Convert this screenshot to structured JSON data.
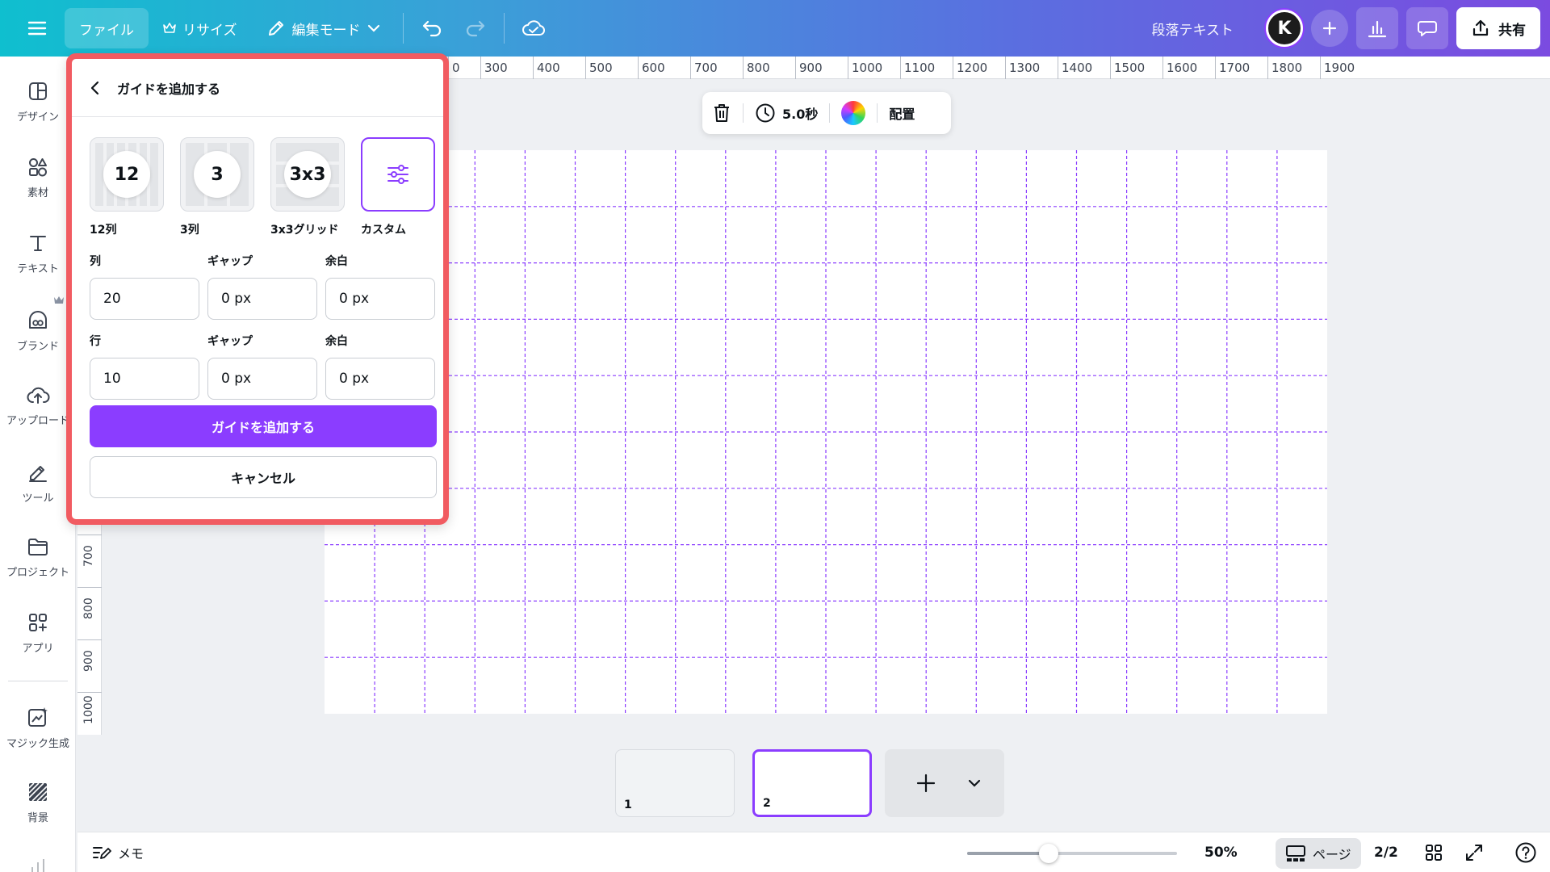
{
  "topbar": {
    "file": "ファイル",
    "resize": "リサイズ",
    "edit_mode": "編集モード",
    "doc_title": "段落テキスト",
    "avatar_text": "K",
    "share": "共有"
  },
  "sidebar": {
    "items": [
      {
        "label": "デザイン",
        "icon": "design-icon"
      },
      {
        "label": "素材",
        "icon": "elements-icon"
      },
      {
        "label": "テキスト",
        "icon": "text-icon"
      },
      {
        "label": "ブランド",
        "icon": "brand-icon"
      },
      {
        "label": "アップロード",
        "icon": "upload-icon"
      },
      {
        "label": "ツール",
        "icon": "tools-icon"
      },
      {
        "label": "プロジェクト",
        "icon": "projects-icon"
      },
      {
        "label": "アプリ",
        "icon": "apps-icon"
      },
      {
        "label": "マジック生成",
        "icon": "magic-icon"
      },
      {
        "label": "背景",
        "icon": "background-icon"
      }
    ]
  },
  "ruler": {
    "top_labels": [
      "0",
      "300",
      "400",
      "500",
      "600",
      "700",
      "800",
      "900",
      "1000",
      "1100",
      "1200",
      "1300",
      "1400",
      "1500",
      "1600",
      "1700",
      "1800",
      "1900"
    ],
    "left_labels": [
      "700",
      "800",
      "900",
      "1000"
    ]
  },
  "float_toolbar": {
    "duration": "5.0秒",
    "arrange": "配置"
  },
  "grid": {
    "columns": 20,
    "rows": 10,
    "color": "#8b3dff"
  },
  "panel": {
    "title": "ガイドを追加する",
    "presets": [
      {
        "symbol": "12",
        "label": "12列"
      },
      {
        "symbol": "3",
        "label": "3列"
      },
      {
        "symbol": "3x3",
        "label": "3x3グリッド"
      },
      {
        "symbol": "",
        "label": "カスタム"
      }
    ],
    "column_label": "列",
    "row_label": "行",
    "gap_label": "ギャップ",
    "margin_label": "余白",
    "columns_value": "20",
    "rows_value": "10",
    "col_gap_value": "0 px",
    "col_margin_value": "0 px",
    "row_gap_value": "0 px",
    "row_margin_value": "0 px",
    "add_button": "ガイドを追加する",
    "cancel_button": "キャンセル"
  },
  "pages": {
    "thumbs": [
      {
        "num": "1"
      },
      {
        "num": "2"
      }
    ]
  },
  "bottombar": {
    "memo": "メモ",
    "zoom": "50%",
    "zoom_level": 0.5,
    "pages_label": "ページ",
    "page_count": "2/2"
  },
  "colors": {
    "accent": "#8b3dff",
    "highlight_border": "#f15b61"
  }
}
